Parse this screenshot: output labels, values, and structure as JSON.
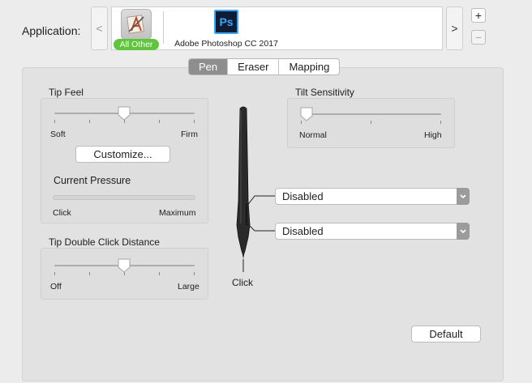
{
  "application": {
    "label": "Application:",
    "scroll_left": "<",
    "scroll_right": ">",
    "items": [
      {
        "name": "All Other",
        "icon": "all-other-app-icon"
      },
      {
        "name": "Adobe Photoshop CC 2017",
        "icon": "photoshop-icon",
        "icon_text": "Ps"
      }
    ],
    "add_label": "+",
    "remove_label": "−"
  },
  "tabs": [
    {
      "label": "Pen",
      "active": true
    },
    {
      "label": "Eraser",
      "active": false
    },
    {
      "label": "Mapping",
      "active": false
    }
  ],
  "tip_feel": {
    "title": "Tip Feel",
    "min_label": "Soft",
    "max_label": "Firm",
    "level": 0.5,
    "customize_label": "Customize...",
    "pressure_title": "Current Pressure",
    "pressure_min": "Click",
    "pressure_max": "Maximum",
    "pressure_level": 0
  },
  "tip_double_click": {
    "title": "Tip Double Click Distance",
    "min_label": "Off",
    "max_label": "Large",
    "level": 0.5
  },
  "tilt": {
    "title": "Tilt Sensitivity",
    "min_label": "Normal",
    "max_label": "High",
    "level": 0
  },
  "pen": {
    "tip_label": "Click",
    "upper_button": "Disabled",
    "lower_button": "Disabled"
  },
  "default_label": "Default",
  "colors": {
    "all_other_badge": "#5fc63b",
    "photoshop_accent": "#31a8ff",
    "active_tab": "#8e8e8e"
  }
}
